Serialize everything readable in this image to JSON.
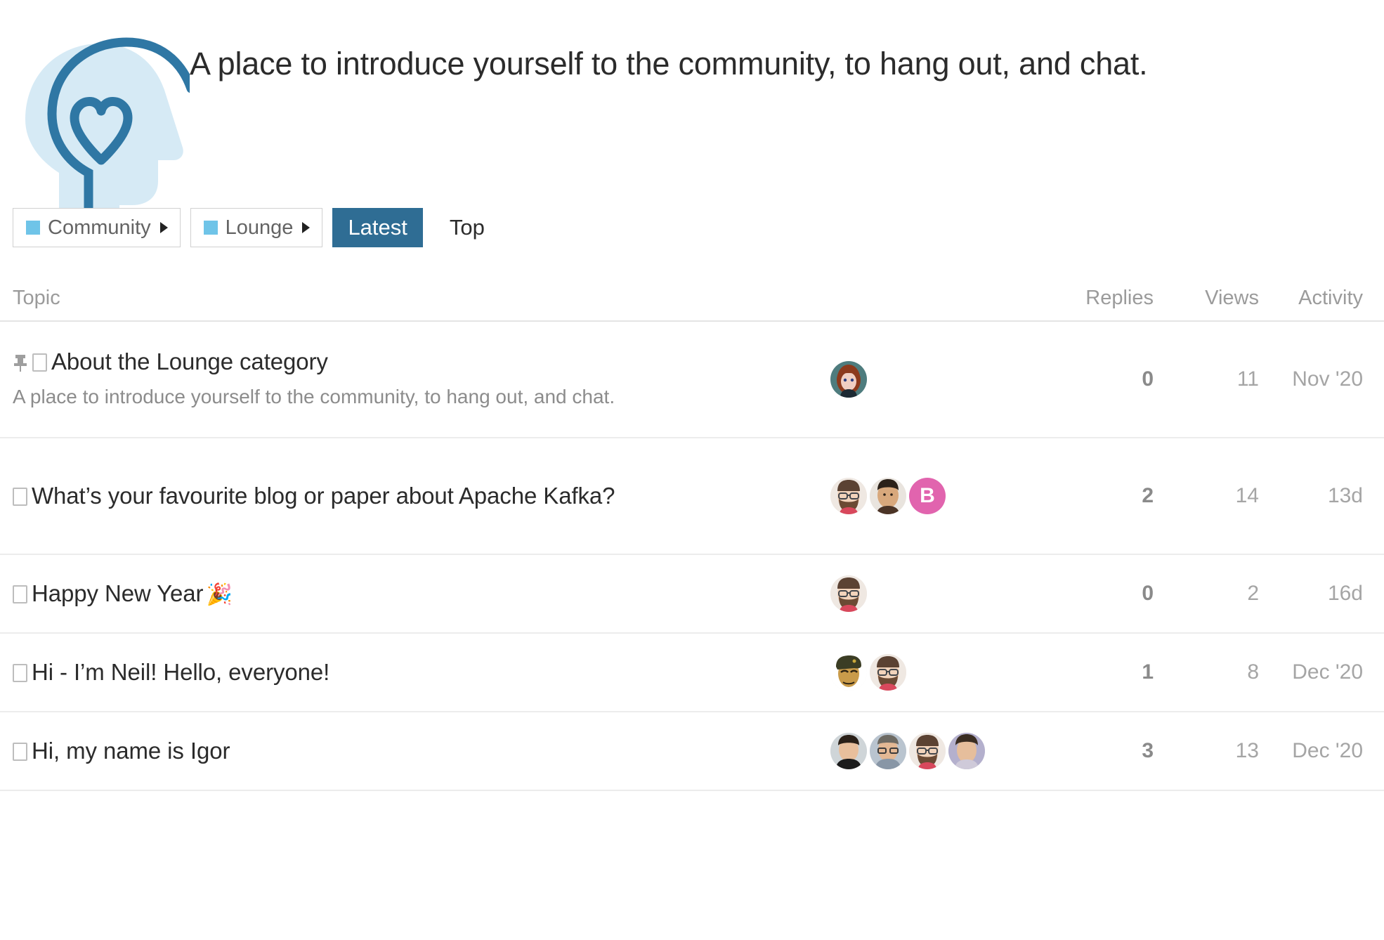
{
  "category": {
    "logo_icon": "head-with-heart-icon",
    "description": "A place to introduce yourself to the community, to hang out, and chat.",
    "logo_colors": {
      "outline": "#2f77a4",
      "fill": "#d6eaf5"
    }
  },
  "nav": {
    "accent_color": "#2f6d94",
    "swatch_color": "#6fc4e8",
    "dropdowns": [
      {
        "label": "Community",
        "swatch": "#6fc4e8",
        "caret": "caret-right-icon"
      },
      {
        "label": "Lounge",
        "swatch": "#6fc4e8",
        "caret": "caret-right-icon"
      }
    ],
    "buttons": [
      {
        "label": "Latest",
        "active": true
      },
      {
        "label": "Top",
        "active": false
      }
    ]
  },
  "table": {
    "columns": {
      "topic": "Topic",
      "replies": "Replies",
      "views": "Views",
      "activity": "Activity"
    },
    "rows": [
      {
        "pinned": true,
        "pin_icon": "pin-icon",
        "glyph": "missing-glyph-box",
        "title": "About the Lounge category",
        "emoji": "",
        "excerpt": "A place to introduce yourself to the community, to hang out, and chat.",
        "posters": [
          {
            "type": "photo",
            "name": "red-haired-woman-avatar"
          }
        ],
        "replies": "0",
        "views": "11",
        "activity": "Nov '20"
      },
      {
        "pinned": false,
        "glyph": "missing-glyph-box",
        "title": "What’s your favourite blog or paper about Apache Kafka?",
        "emoji": "",
        "excerpt": "",
        "posters": [
          {
            "type": "photo",
            "name": "bearded-man-glasses-avatar"
          },
          {
            "type": "photo",
            "name": "dark-haired-man-avatar"
          },
          {
            "type": "letter",
            "name": "letter-avatar-b",
            "letter": "B",
            "color": "#e164ae"
          }
        ],
        "replies": "2",
        "views": "14",
        "activity": "13d"
      },
      {
        "pinned": false,
        "glyph": "missing-glyph-box",
        "title": "Happy New Year",
        "emoji": "🎉",
        "excerpt": "",
        "posters": [
          {
            "type": "photo",
            "name": "bearded-man-glasses-avatar"
          }
        ],
        "replies": "0",
        "views": "2",
        "activity": "16d"
      },
      {
        "pinned": false,
        "glyph": "missing-glyph-box",
        "title": "Hi - I’m Neil! Hello, everyone!",
        "emoji": "",
        "excerpt": "",
        "posters": [
          {
            "type": "photo",
            "name": "soldier-cap-avatar"
          },
          {
            "type": "photo",
            "name": "bearded-man-glasses-avatar"
          }
        ],
        "replies": "1",
        "views": "8",
        "activity": "Dec '20"
      },
      {
        "pinned": false,
        "glyph": "missing-glyph-box",
        "title": "Hi, my name is Igor",
        "emoji": "",
        "excerpt": "",
        "posters": [
          {
            "type": "photo",
            "name": "short-hair-man-avatar"
          },
          {
            "type": "photo",
            "name": "older-man-glasses-avatar"
          },
          {
            "type": "photo",
            "name": "bearded-man-glasses-avatar"
          },
          {
            "type": "photo",
            "name": "curly-hair-man-avatar"
          }
        ],
        "replies": "3",
        "views": "13",
        "activity": "Dec '20"
      }
    ]
  }
}
